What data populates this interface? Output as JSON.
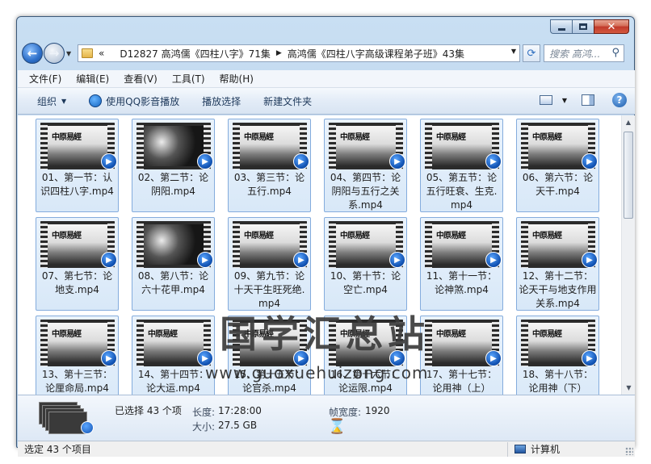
{
  "window": {
    "caption": {
      "minimize": "–",
      "maximize": "□",
      "close": "✕"
    }
  },
  "nav": {
    "back_icon": "back-arrow-icon",
    "forward_icon": "forward-arrow-icon",
    "breadcrumb_prefix": "«",
    "crumbs": [
      "D12827 高鸿儒《四柱八字》71集",
      "高鸿儒《四柱八字高级课程弟子班》43集"
    ],
    "refresh_icon": "refresh-icon",
    "search_placeholder": "搜索 高鸿..."
  },
  "menu": [
    "文件(F)",
    "编辑(E)",
    "查看(V)",
    "工具(T)",
    "帮助(H)"
  ],
  "toolbar": {
    "organize": "组织",
    "play_qq": "使用QQ影音播放",
    "play_selection": "播放选择",
    "new_folder": "新建文件夹"
  },
  "thumb_title": "中原易經",
  "files": [
    {
      "label": "01、第一节：认识四柱八字.mp4",
      "dark": false
    },
    {
      "label": "02、第二节：论阴阳.mp4",
      "dark": true
    },
    {
      "label": "03、第三节：论五行.mp4",
      "dark": false
    },
    {
      "label": "04、第四节：论阴阳与五行之关系.mp4",
      "dark": false
    },
    {
      "label": "05、第五节：论五行旺衰、生克.mp4",
      "dark": false
    },
    {
      "label": "06、第六节：论天干.mp4",
      "dark": false
    },
    {
      "label": "07、第七节：论地支.mp4",
      "dark": false
    },
    {
      "label": "08、第八节：论六十花甲.mp4",
      "dark": true
    },
    {
      "label": "09、第九节：论十天干生旺死绝.mp4",
      "dark": false
    },
    {
      "label": "10、第十节：论空亡.mp4",
      "dark": false
    },
    {
      "label": "11、第十一节：论神煞.mp4",
      "dark": false
    },
    {
      "label": "12、第十二节：论天干与地支作用关系.mp4",
      "dark": false
    },
    {
      "label": "13、第十三节：论厘命局.mp4",
      "dark": false
    },
    {
      "label": "14、第十四节：论大运.mp4",
      "dark": false
    },
    {
      "label": "15、第十五节：论官杀.mp4",
      "dark": false
    },
    {
      "label": "16、第十六节：论运限.mp4",
      "dark": false
    },
    {
      "label": "17、第十七节：论用神（上）",
      "dark": false
    },
    {
      "label": "18、第十八节：论用神（下）",
      "dark": false
    }
  ],
  "watermark": {
    "text": "国学汇总站",
    "url": "www.guoxuehuizong.com"
  },
  "details": {
    "selected": "已选择 43 个项",
    "length_label": "长度:",
    "length_value": "17:28:00",
    "size_label": "大小:",
    "size_value": "27.5 GB",
    "width_label": "帧宽度:",
    "width_value": "1920"
  },
  "status": {
    "left": "选定 43 个项目",
    "right": "计算机"
  },
  "colors": {
    "tile_border": "#84acdd",
    "badge": "#1253b3"
  }
}
